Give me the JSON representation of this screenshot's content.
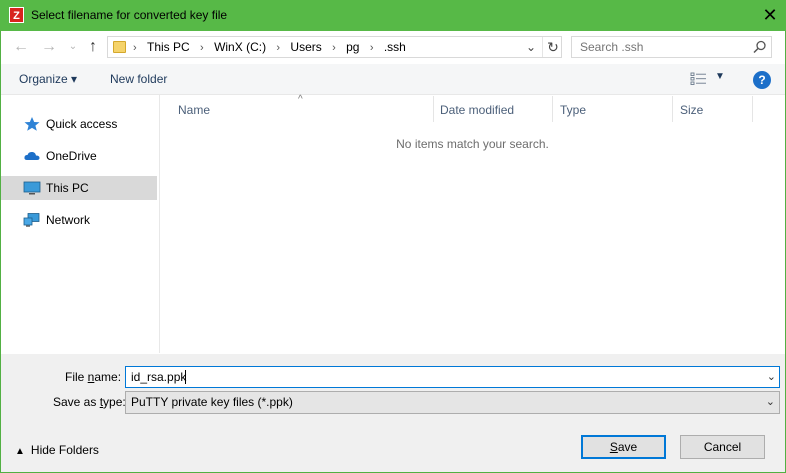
{
  "window": {
    "title": "Select filename for converted key file",
    "app_icon_letter": "Z",
    "close_glyph": "✕"
  },
  "address": {
    "crumbs": [
      "This PC",
      "WinX (C:)",
      "Users",
      "pg",
      ".ssh"
    ]
  },
  "search": {
    "placeholder": "Search .ssh"
  },
  "commandbar": {
    "organize_label": "Organize ▾",
    "new_folder_label": "New folder",
    "help_glyph": "?"
  },
  "nav": {
    "items": [
      {
        "label": "Quick access",
        "icon": "star-icon",
        "selected": false
      },
      {
        "label": "OneDrive",
        "icon": "cloud-icon",
        "selected": false
      },
      {
        "label": "This PC",
        "icon": "computer-icon",
        "selected": true
      },
      {
        "label": "Network",
        "icon": "network-icon",
        "selected": false
      }
    ]
  },
  "filelist": {
    "columns": [
      "Name",
      "Date modified",
      "Type",
      "Size"
    ],
    "empty_message": "No items match your search."
  },
  "bottom": {
    "file_name_label_pre": "File ",
    "file_name_label_underlined": "n",
    "file_name_label_post": "ame:",
    "file_name_value": "id_rsa.ppk",
    "save_type_label_pre": "Save as ",
    "save_type_label_underlined": "t",
    "save_type_label_post": "ype:",
    "save_type_value": "PuTTY private key files (*.ppk)",
    "hide_folders_label": "Hide Folders",
    "save_label_underlined": "S",
    "save_label_rest": "ave",
    "cancel_label": "Cancel"
  },
  "colors": {
    "title_bar": "#57b947",
    "accent": "#0078d7",
    "selection": "#d9d9d9"
  }
}
